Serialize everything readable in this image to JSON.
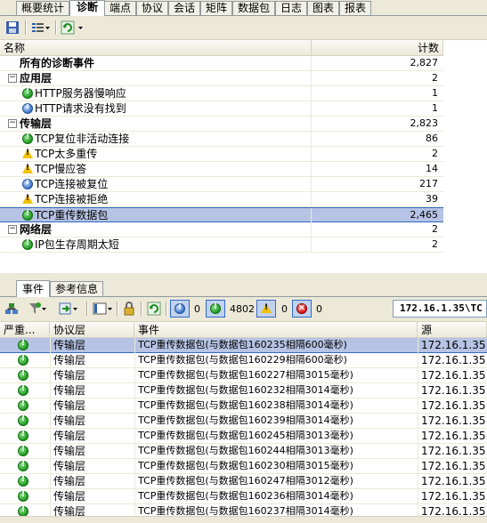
{
  "tabs": [
    "概要统计",
    "诊断",
    "端点",
    "协议",
    "会话",
    "矩阵",
    "数据包",
    "日志",
    "图表",
    "报表"
  ],
  "active_tab": "诊断",
  "tree": {
    "columns": {
      "name": "名称",
      "count": "计数"
    },
    "rows": [
      {
        "label": "所有的诊断事件",
        "count": "2,827",
        "kind": "root"
      },
      {
        "label": "应用层",
        "count": "2",
        "kind": "group"
      },
      {
        "label": "HTTP服务器慢响应",
        "count": "1",
        "kind": "item",
        "icon": "ok"
      },
      {
        "label": "HTTP请求没有找到",
        "count": "1",
        "kind": "item",
        "icon": "info"
      },
      {
        "label": "传输层",
        "count": "2,823",
        "kind": "group"
      },
      {
        "label": "TCP复位非活动连接",
        "count": "86",
        "kind": "item",
        "icon": "ok"
      },
      {
        "label": "TCP太多重传",
        "count": "2",
        "kind": "item",
        "icon": "warn"
      },
      {
        "label": "TCP慢应答",
        "count": "14",
        "kind": "item",
        "icon": "warn"
      },
      {
        "label": "TCP连接被复位",
        "count": "217",
        "kind": "item",
        "icon": "info"
      },
      {
        "label": "TCP连接被拒绝",
        "count": "39",
        "kind": "item",
        "icon": "warn"
      },
      {
        "label": "TCP重传数据包",
        "count": "2,465",
        "kind": "item",
        "icon": "ok",
        "selected": true
      },
      {
        "label": "网络层",
        "count": "2",
        "kind": "group"
      },
      {
        "label": "IP包生存周期太短",
        "count": "2",
        "kind": "item",
        "icon": "ok"
      }
    ]
  },
  "bottom_tabs": [
    "事件",
    "参考信息"
  ],
  "bottom_toolbar": {
    "info_count": "0",
    "ok_count": "4802",
    "warn_count": "0",
    "err_count": "0",
    "address_filter": "172.16.1.35\\TC"
  },
  "list": {
    "columns": {
      "severity": "严重...",
      "layer": "协议层",
      "event": "事件",
      "source": "源"
    },
    "rows": [
      {
        "layer": "传输层",
        "event": "TCP重传数据包(与数据包160235相隔600毫秒)",
        "source": "172.16.1.35",
        "selected": true
      },
      {
        "layer": "传输层",
        "event": "TCP重传数据包(与数据包160229相隔600毫秒)",
        "source": "172.16.1.35"
      },
      {
        "layer": "传输层",
        "event": "TCP重传数据包(与数据包160227相隔3015毫秒)",
        "source": "172.16.1.35"
      },
      {
        "layer": "传输层",
        "event": "TCP重传数据包(与数据包160232相隔3014毫秒)",
        "source": "172.16.1.35"
      },
      {
        "layer": "传输层",
        "event": "TCP重传数据包(与数据包160238相隔3014毫秒)",
        "source": "172.16.1.35"
      },
      {
        "layer": "传输层",
        "event": "TCP重传数据包(与数据包160239相隔3014毫秒)",
        "source": "172.16.1.35"
      },
      {
        "layer": "传输层",
        "event": "TCP重传数据包(与数据包160245相隔3013毫秒)",
        "source": "172.16.1.35"
      },
      {
        "layer": "传输层",
        "event": "TCP重传数据包(与数据包160244相隔3013毫秒)",
        "source": "172.16.1.35"
      },
      {
        "layer": "传输层",
        "event": "TCP重传数据包(与数据包160230相隔3015毫秒)",
        "source": "172.16.1.35"
      },
      {
        "layer": "传输层",
        "event": "TCP重传数据包(与数据包160247相隔3012毫秒)",
        "source": "172.16.1.35"
      },
      {
        "layer": "传输层",
        "event": "TCP重传数据包(与数据包160236相隔3014毫秒)",
        "source": "172.16.1.35"
      },
      {
        "layer": "传输层",
        "event": "TCP重传数据包(与数据包160237相隔3014毫秒)",
        "source": "172.16.1.35"
      }
    ]
  }
}
